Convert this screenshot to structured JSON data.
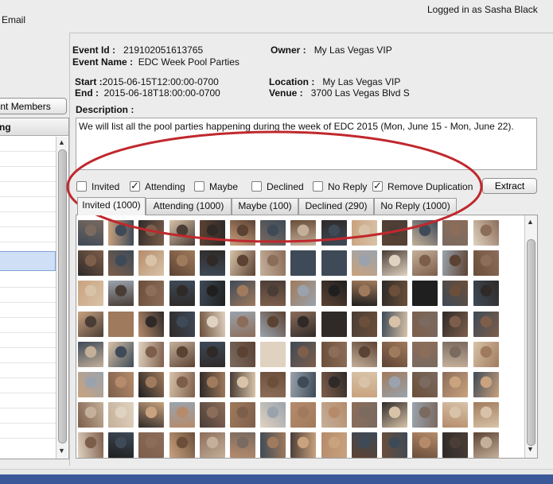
{
  "menu": {
    "email_label": "Email"
  },
  "session": {
    "logged_in_text": "Logged in as Sasha Black"
  },
  "left_panel": {
    "button_label": "ount Members",
    "list_header": "ng",
    "scroll_up": "▲",
    "scroll_down": "▼"
  },
  "event": {
    "id_label": "Event Id :",
    "id_value": "219102051613765",
    "name_label": "Event Name :",
    "name_value": "EDC Week Pool Parties",
    "owner_label": "Owner :",
    "owner_value": "My Las Vegas VIP",
    "start_label": "Start :",
    "start_value": "2015-06-15T12:00:00-0700",
    "end_label": "End :",
    "end_value": "2015-06-18T18:00:00-0700",
    "location_label": "Location :",
    "location_value": "My Las Vegas VIP",
    "venue_label": "Venue :",
    "venue_value": "3700 Las Vegas Blvd S",
    "description_label": "Description :",
    "description_text": "We will list all the pool parties happening during the week of EDC 2015 (Mon, June 15 - Mon, June 22)."
  },
  "filters": [
    {
      "label": "Invited",
      "checked": false
    },
    {
      "label": "Attending",
      "checked": true
    },
    {
      "label": "Maybe",
      "checked": false
    },
    {
      "label": "Declined",
      "checked": false
    },
    {
      "label": "No Reply",
      "checked": false
    },
    {
      "label": "Remove Duplication",
      "checked": true
    }
  ],
  "extract_label": "Extract",
  "tabs": [
    {
      "label": "Invited (1000)",
      "active": true
    },
    {
      "label": "Attending (1000)",
      "active": false
    },
    {
      "label": "Maybe (100)",
      "active": false
    },
    {
      "label": "Declined (290)",
      "active": false
    },
    {
      "label": "No Reply (1000)",
      "active": false
    }
  ],
  "grid": {
    "scroll_up": "▲",
    "scroll_down": "▼",
    "rows": 8,
    "cols": 14,
    "palette": [
      "#6b4f3a",
      "#2f2a28",
      "#a07a5c",
      "#c9a27e",
      "#4a3d36",
      "#8c6d5a",
      "#d8c3a8",
      "#3e4a57",
      "#7a6a60",
      "#b58b6b",
      "#5c4233",
      "#9aa3ad",
      "#e0d2c0",
      "#1f1f1f",
      "#7d5e4b",
      "#c4b09a"
    ]
  },
  "colors": {
    "annotation": "#c0282d",
    "footer": "#3b5998"
  }
}
